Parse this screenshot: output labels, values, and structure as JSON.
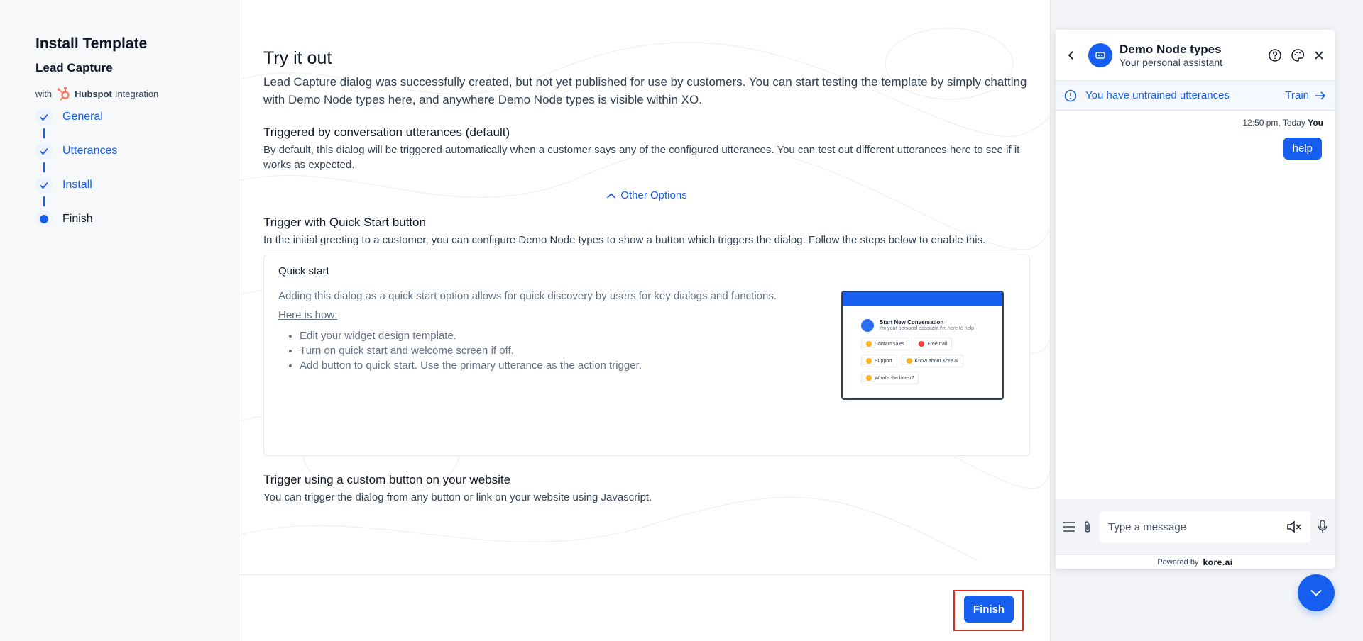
{
  "sidebar": {
    "title": "Install Template",
    "template_name": "Lead Capture",
    "with_prefix": "with",
    "integration_brand": "Hubspot",
    "integration_suffix": "Integration",
    "steps": [
      {
        "label": "General",
        "state": "done"
      },
      {
        "label": "Utterances",
        "state": "done"
      },
      {
        "label": "Install",
        "state": "done"
      },
      {
        "label": "Finish",
        "state": "current"
      }
    ]
  },
  "main": {
    "title": "Try it out",
    "lead": "Lead Capture dialog was successfully created, but not yet published for use by customers. You can start testing the template by simply chatting with Demo Node types here, and anywhere Demo Node types is visible within XO.",
    "section1": {
      "title": "Triggered by conversation utterances (default)",
      "text": "By default, this dialog will be triggered automatically when a customer says any of the configured utterances. You can test out different utterances here to see if it works as expected."
    },
    "other_options": "Other Options",
    "section2": {
      "title": "Trigger with Quick Start button",
      "text": "In the initial greeting to a customer, you can configure Demo Node types to show a button which triggers the dialog. Follow the steps below to enable this."
    },
    "quick_start": {
      "title": "Quick start",
      "description": "Adding this dialog as a quick start option allows for quick discovery by users for key dialogs and functions.",
      "howto": "Here is how:",
      "steps": [
        "Edit your widget design template.",
        "Turn on quick start and welcome screen if off.",
        "Add button to quick start. Use the primary utterance as the action trigger."
      ],
      "preview": {
        "title": "Start New Conversation",
        "subtitle": "I'm your personal assistant I'm here to help",
        "chips": [
          "Contact sales",
          "Free trail",
          "Support",
          "Know about Kore.ai",
          "What's the latest?"
        ]
      }
    },
    "section3": {
      "title": "Trigger using a custom button on your website",
      "text": "You can trigger the dialog from any button or link on your website using Javascript."
    },
    "finish_button": "Finish"
  },
  "chat": {
    "bot_name": "Demo Node types",
    "bot_subtitle": "Your personal assistant",
    "untrained_text": "You have untrained utterances",
    "train_label": "Train",
    "message_time": "12:50 pm, Today",
    "message_sender": "You",
    "message_text": "help",
    "input_placeholder": "Type a message",
    "powered_by": "Powered by",
    "powered_brand": "kore.ai"
  },
  "colors": {
    "accent": "#155eef",
    "highlight": "#d92d20",
    "hubspot": "#ff7a59"
  },
  "icons": [
    "check-icon",
    "hubspot-logo-icon",
    "chevron-up-icon",
    "back-arrow-icon",
    "bot-avatar-icon",
    "help-icon",
    "palette-icon",
    "close-icon",
    "info-icon",
    "arrow-right-icon",
    "menu-icon",
    "attachment-icon",
    "mute-icon",
    "microphone-icon",
    "chevron-down-icon"
  ]
}
